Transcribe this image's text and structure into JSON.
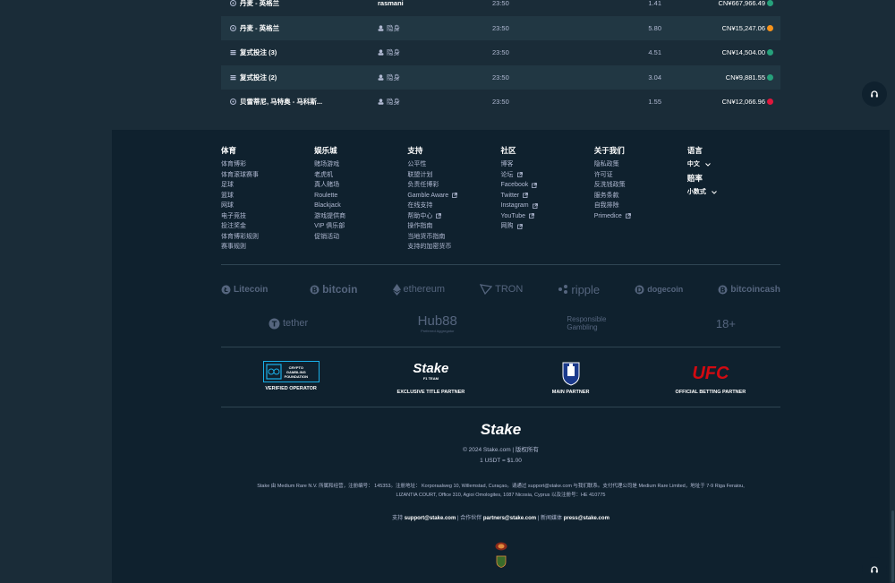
{
  "bets": [
    {
      "game": "丹麦 - 英格兰",
      "icon": "soccer-icon",
      "user": "rasmani",
      "user_named": true,
      "time": "23:50",
      "multiplier": "1.41",
      "payout": "CN¥667,966.49",
      "coin": "usdt",
      "coin_color": "#26a17b",
      "alt": false
    },
    {
      "game": "丹麦 - 英格兰",
      "icon": "soccer-icon",
      "user": "隐身",
      "user_named": false,
      "time": "23:50",
      "multiplier": "5.80",
      "payout": "CN¥15,247.06",
      "coin": "btc",
      "coin_color": "#f7931a",
      "alt": true
    },
    {
      "game": "复式投注 (3)",
      "icon": "stack-icon",
      "user": "隐身",
      "user_named": false,
      "time": "23:50",
      "multiplier": "4.51",
      "payout": "CN¥14,504.00",
      "coin": "usdt",
      "coin_color": "#26a17b",
      "alt": false
    },
    {
      "game": "复式投注 (2)",
      "icon": "stack-icon",
      "user": "隐身",
      "user_named": false,
      "time": "23:50",
      "multiplier": "3.04",
      "payout": "CN¥9,881.55",
      "coin": "usdt",
      "coin_color": "#26a17b",
      "alt": true
    },
    {
      "game": "贝雷蒂尼, 马特奥 - 马科斯...",
      "icon": "tennis-icon",
      "user": "隐身",
      "user_named": false,
      "time": "23:50",
      "multiplier": "1.55",
      "payout": "CN¥12,066.96",
      "coin": "trx",
      "coin_color": "#e0173c",
      "alt": false
    }
  ],
  "footer": {
    "columns": [
      {
        "title": "体育",
        "links": [
          {
            "label": "体育博彩",
            "ext": false
          },
          {
            "label": "体育滚球赛事",
            "ext": false
          },
          {
            "label": "足球",
            "ext": false
          },
          {
            "label": "篮球",
            "ext": false
          },
          {
            "label": "网球",
            "ext": false
          },
          {
            "label": "电子竞技",
            "ext": false
          },
          {
            "label": "投注奖金",
            "ext": false
          },
          {
            "label": "体育博彩规则",
            "ext": false
          },
          {
            "label": "赛事规则",
            "ext": false
          }
        ]
      },
      {
        "title": "娱乐城",
        "links": [
          {
            "label": "赌场游戏",
            "ext": false
          },
          {
            "label": "老虎机",
            "ext": false
          },
          {
            "label": "真人赌场",
            "ext": false
          },
          {
            "label": "Roulette",
            "ext": false
          },
          {
            "label": "Blackjack",
            "ext": false
          },
          {
            "label": "游戏提供商",
            "ext": false
          },
          {
            "label": "VIP 俱乐部",
            "ext": false
          },
          {
            "label": "促销活动",
            "ext": false
          }
        ]
      },
      {
        "title": "支持",
        "links": [
          {
            "label": "公平性",
            "ext": false
          },
          {
            "label": "联盟计划",
            "ext": false
          },
          {
            "label": "负责任博彩",
            "ext": false
          },
          {
            "label": "Gamble Aware",
            "ext": true
          },
          {
            "label": "在线支持",
            "ext": false
          },
          {
            "label": "帮助中心",
            "ext": true
          },
          {
            "label": "操作指南",
            "ext": false
          },
          {
            "label": "当地货币指南",
            "ext": false
          },
          {
            "label": "支持的加密货币",
            "ext": false
          }
        ]
      },
      {
        "title": "社区",
        "links": [
          {
            "label": "博客",
            "ext": false
          },
          {
            "label": "论坛",
            "ext": true
          },
          {
            "label": "Facebook",
            "ext": true
          },
          {
            "label": "Twitter",
            "ext": true
          },
          {
            "label": "Instagram",
            "ext": true
          },
          {
            "label": "YouTube",
            "ext": true
          },
          {
            "label": "网购",
            "ext": true
          }
        ]
      },
      {
        "title": "关于我们",
        "links": [
          {
            "label": "隐私政策",
            "ext": false
          },
          {
            "label": "许可证",
            "ext": false
          },
          {
            "label": "反洗钱政策",
            "ext": false
          },
          {
            "label": "服务条款",
            "ext": false
          },
          {
            "label": "自我排除",
            "ext": false
          },
          {
            "label": "Primedice",
            "ext": true
          }
        ]
      }
    ],
    "language": {
      "title": "语言",
      "value": "中文"
    },
    "odds": {
      "title": "赔率",
      "value": "小数式"
    },
    "crypto_logos": [
      "Litecoin",
      "bitcoin",
      "ethereum",
      "TRON",
      "ripple",
      "dogecoin",
      "bitcoincash"
    ],
    "misc_logos": [
      "tether",
      "Hub88",
      "Responsible",
      "Gambling",
      "18+"
    ],
    "hub88_sub": "Preferred Aggregator",
    "partners": {
      "cgf_lines": [
        "CRYPTO",
        "GAMBLING",
        "FOUNDATION"
      ],
      "cgf_caption": "VERIFIED OPERATOR",
      "stake_f1": "Stake",
      "f1_team": "F1 TEAM",
      "f1_caption": "EXCLUSIVE TITLE PARTNER",
      "everton_caption": "MAIN PARTNER",
      "ufc": "UFC",
      "ufc_caption": "OFFICIAL BETTING PARTNER"
    },
    "brand": "Stake",
    "copyright": "© 2024 Stake.com | 版权所有",
    "rate": "1 USDT = $1.00",
    "legal_1": "Stake 由 Medium Rare N.V. 所属和经营，注册编号：  145353。注册地址：  Korporaalweg 10, Willemstad, Curaçao。请通过 support@stake.com 与我们联系。支付代理公司是 Medium Rare Limited，地址于 7-9 Riga Feraiou,",
    "legal_2": "LIZANTIA COURT, Office 310, Agioi Omologites, 1087 Nicosia, Cyprus 以及注册号：HE 410775",
    "contact": {
      "support_label": "支持",
      "support_email": "support@stake.com",
      "partners_label": "| 合作伙伴",
      "partners_email": "partners@stake.com",
      "press_label": "| 新闻媒体",
      "press_email": "press@stake.com"
    }
  }
}
